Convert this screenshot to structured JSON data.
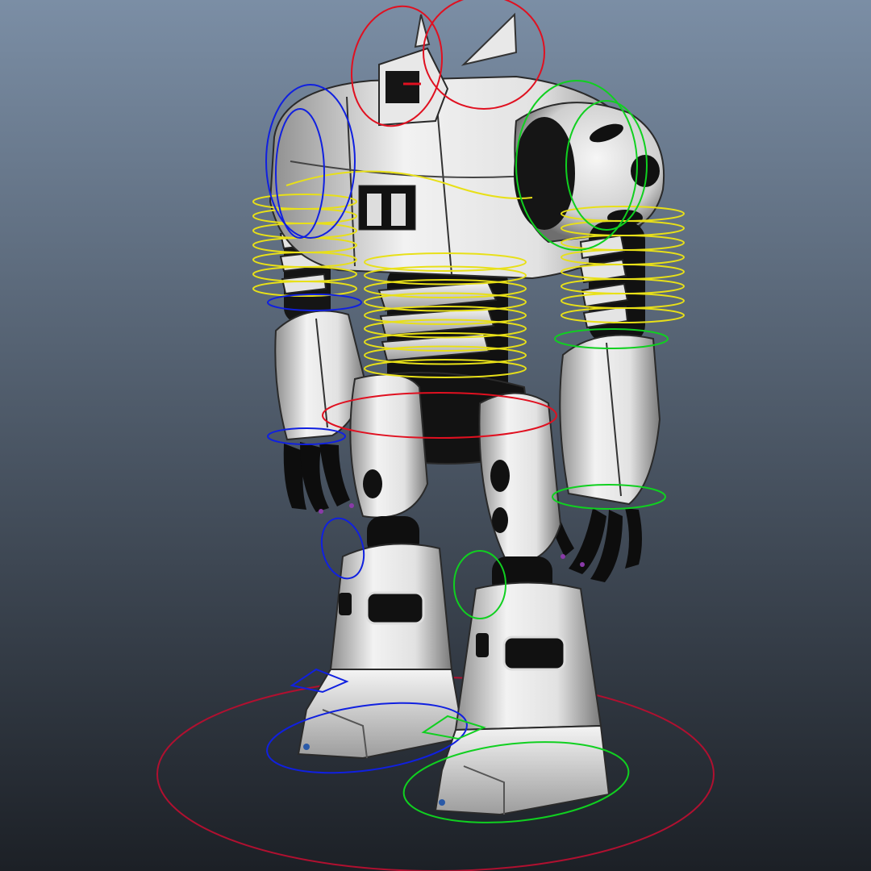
{
  "viewport": {
    "background_top": "#7b8ea5",
    "background_bottom": "#1c2026"
  },
  "model": {
    "name": "robot-mech",
    "body_color": "#e6e6e6",
    "shadow_color": "#9a9a9a",
    "joint_color": "#0c0c0c"
  },
  "rig_controls": {
    "colors": {
      "center": "#e01020",
      "spine": "#e8e018",
      "left": "#1020e0",
      "right": "#10d020",
      "root": "#b01030"
    }
  }
}
